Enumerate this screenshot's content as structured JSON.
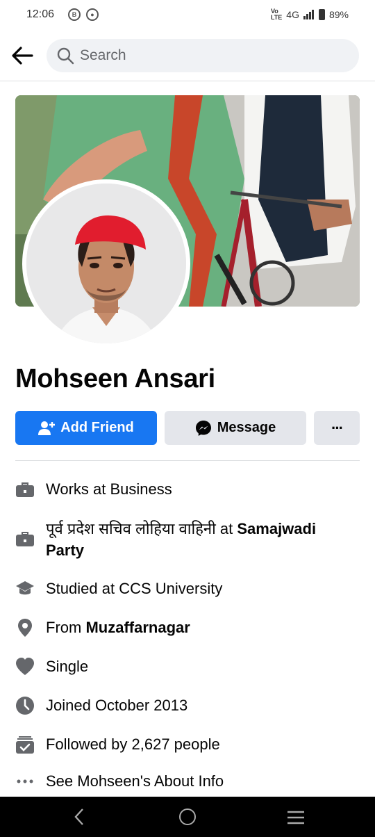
{
  "status_bar": {
    "time": "12:06",
    "left_icons": [
      "b-circle-icon",
      "chrome-icon"
    ],
    "network": "4G",
    "battery": "89%"
  },
  "search": {
    "placeholder": "Search"
  },
  "profile": {
    "name": "Mohseen Ansari"
  },
  "actions": {
    "add_friend": "Add Friend",
    "message": "Message",
    "more": "···"
  },
  "info": {
    "work1": "Works at Business",
    "work2_prefix": "पूर्व प्रदेश सचिव लोहिया वाहिनी at ",
    "work2_org": "Samajwadi Party",
    "education": "Studied at CCS University",
    "from_prefix": "From ",
    "from_place": "Muzaffarnagar",
    "relationship": "Single",
    "joined": "Joined October 2013",
    "followers": "Followed by 2,627 people",
    "about": "See Mohseen's About Info"
  },
  "colors": {
    "accent": "#1877f2",
    "icon_gray": "#65676b",
    "button_gray": "#e4e6eb"
  }
}
